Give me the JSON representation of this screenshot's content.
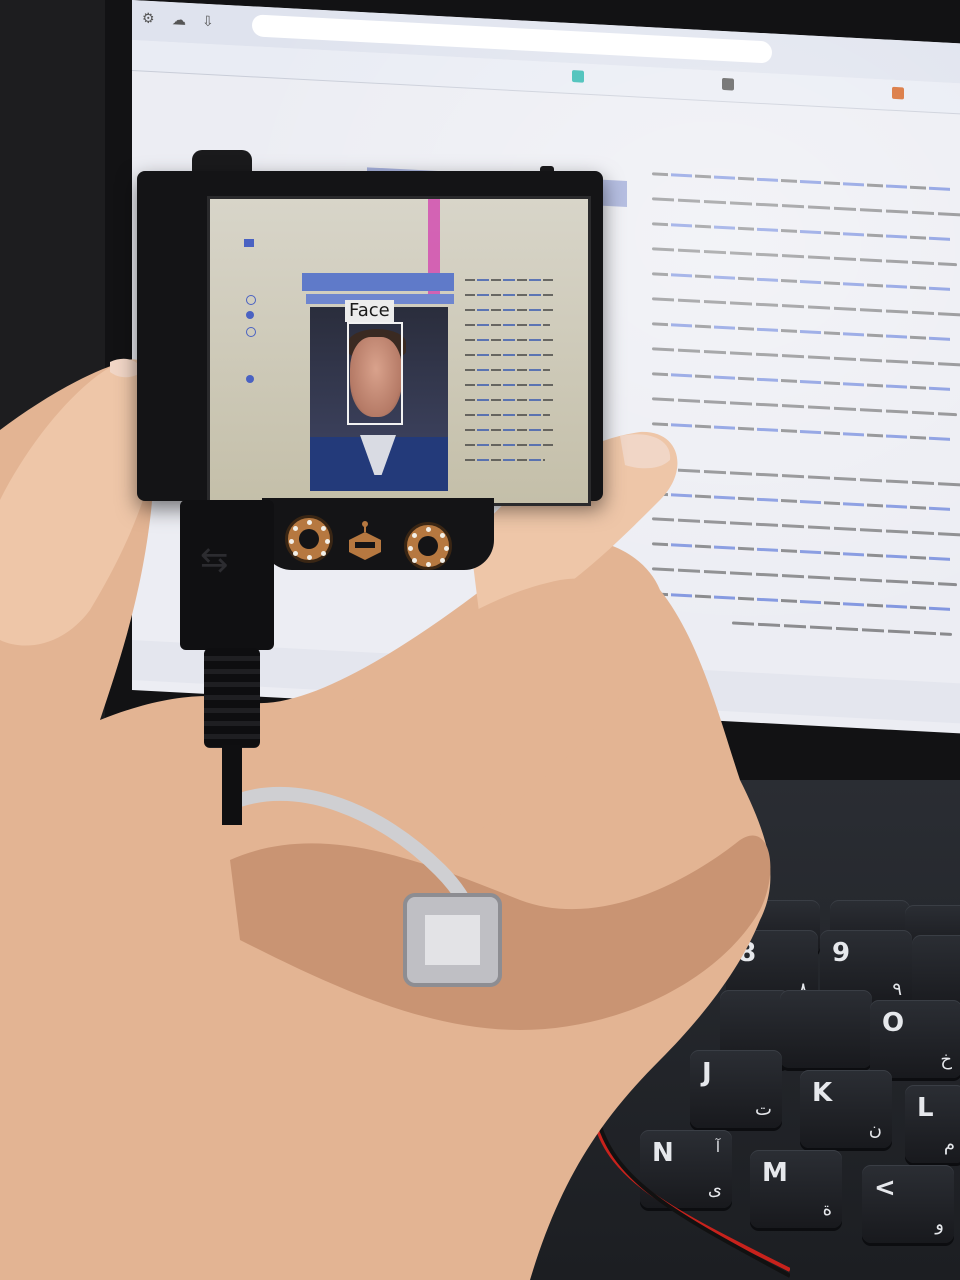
{
  "scene": {
    "description_free": true
  },
  "device_display": {
    "detection_label": "Face"
  },
  "keyboard": {
    "keys": [
      {
        "id": "J",
        "latin": "J",
        "arabic": "ت"
      },
      {
        "id": "K",
        "latin": "K",
        "arabic": "ن"
      },
      {
        "id": "L",
        "latin": "L",
        "arabic": "م"
      },
      {
        "id": "N",
        "latin": "N",
        "arabic": "ى",
        "arabic_top": "آ"
      },
      {
        "id": "M",
        "latin": "M",
        "arabic": "ة"
      },
      {
        "id": "lt",
        "latin": "<",
        "arabic": "و"
      },
      {
        "id": "O",
        "latin": "O",
        "arabic": "خ"
      },
      {
        "id": "nine",
        "latin": "9",
        "arabic": "٩"
      },
      {
        "id": "eight",
        "latin": "8",
        "arabic": "٨"
      }
    ]
  },
  "colors": {
    "bounding_box": "#f2f2f2",
    "ring_copper": "#b67840",
    "wire_red": "#c8221c",
    "display_infobox": "#5f7ac9",
    "display_pink": "#d24fb0"
  }
}
